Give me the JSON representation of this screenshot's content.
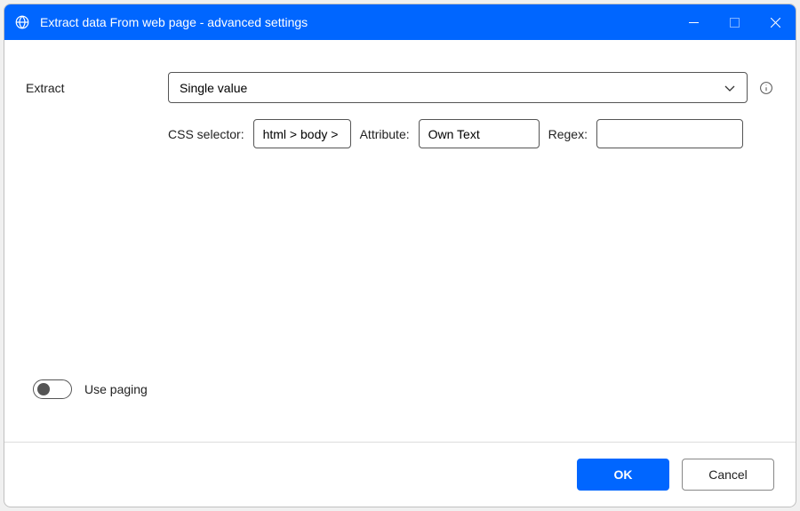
{
  "window": {
    "title": "Extract data From web page - advanced settings"
  },
  "form": {
    "extract_label": "Extract",
    "extract_value": "Single value",
    "css_selector_label": "CSS selector:",
    "css_selector_value": "html > body >",
    "attribute_label": "Attribute:",
    "attribute_value": "Own Text",
    "regex_label": "Regex:",
    "regex_value": "",
    "use_paging_label": "Use paging"
  },
  "footer": {
    "ok_label": "OK",
    "cancel_label": "Cancel"
  }
}
